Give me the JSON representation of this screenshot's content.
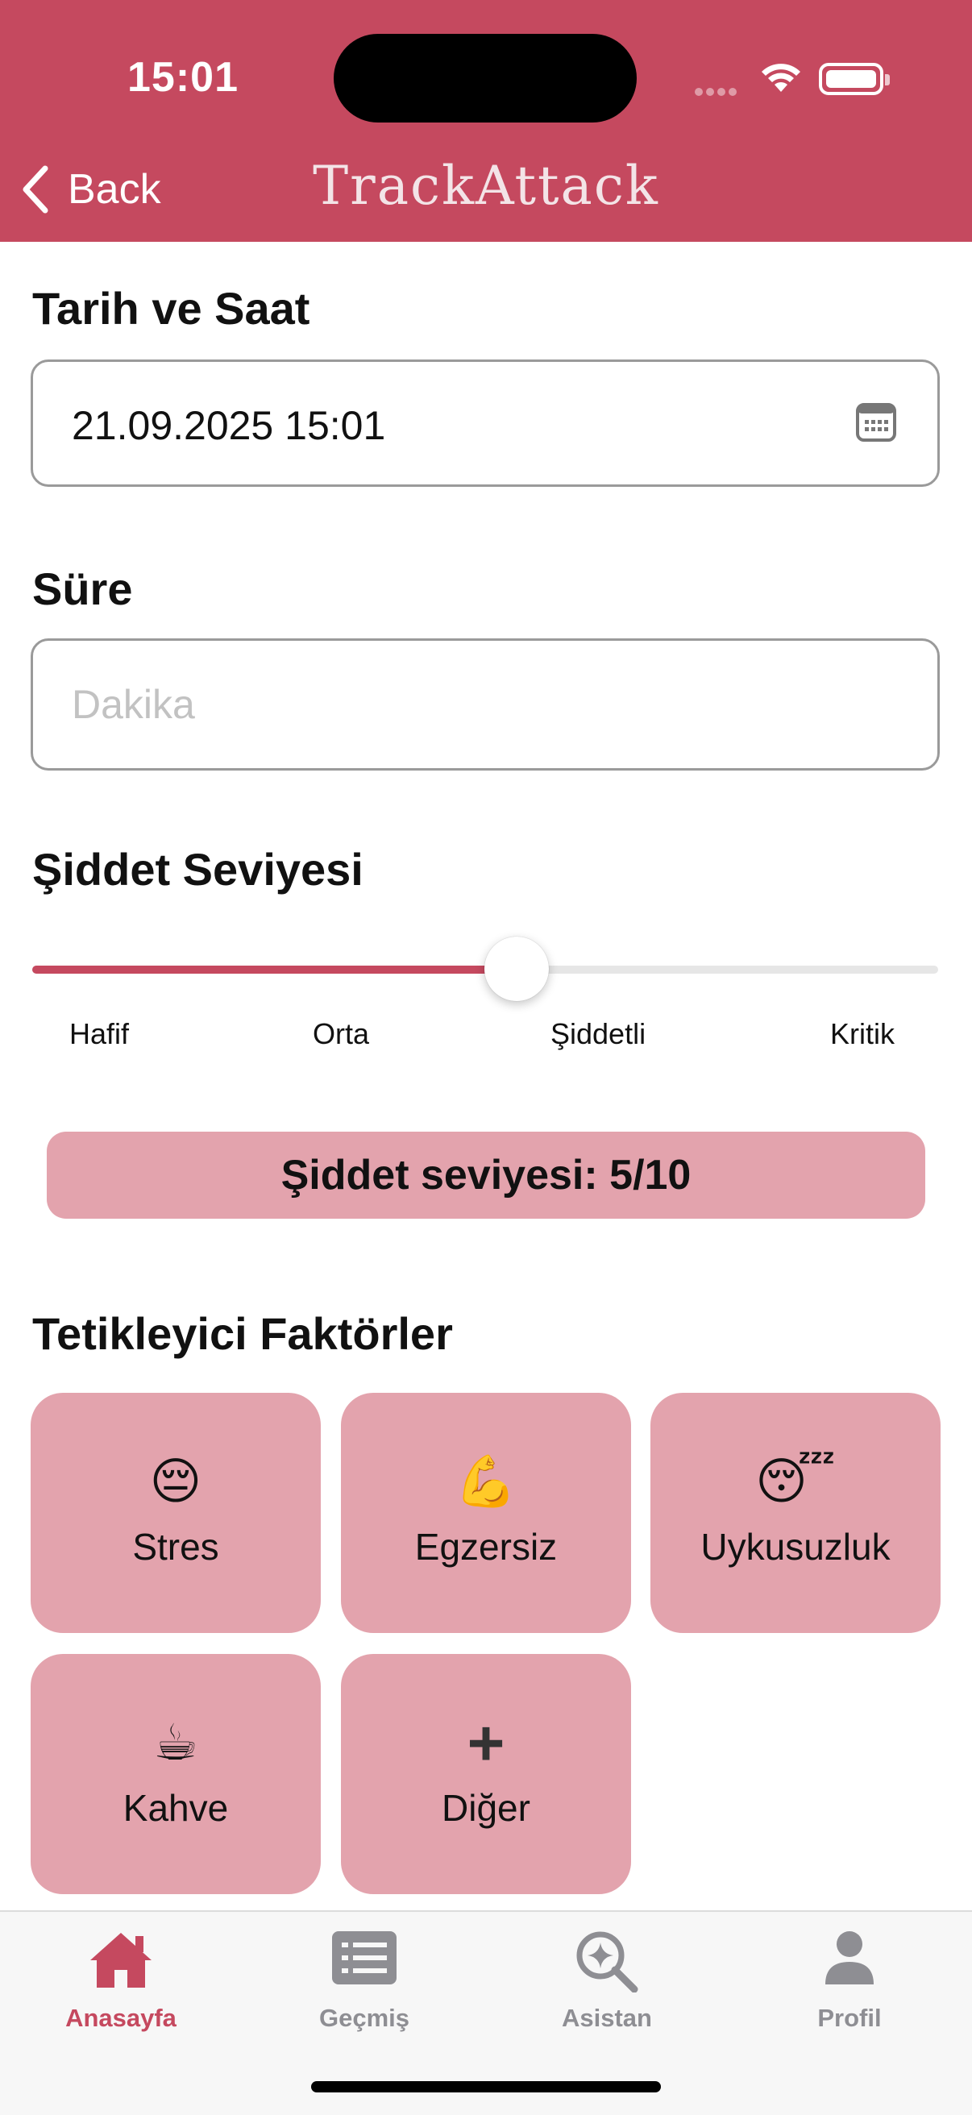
{
  "status_bar": {
    "time": "15:01"
  },
  "nav": {
    "back_label": "Back",
    "title": "TrackAttack"
  },
  "form": {
    "datetime": {
      "label": "Tarih ve Saat",
      "value": "21.09.2025 15:01"
    },
    "duration": {
      "label": "Süre",
      "placeholder": "Dakika",
      "value": ""
    },
    "severity": {
      "label": "Şiddet Seviyesi",
      "value": 5,
      "max": 10,
      "ticks": [
        "Hafif",
        "Orta",
        "Şiddetli",
        "Kritik"
      ],
      "summary": "Şiddet seviyesi: 5/10"
    },
    "triggers": {
      "label": "Tetikleyici Faktörler",
      "items": [
        {
          "emoji": "😔",
          "label": "Stres"
        },
        {
          "emoji": "💪",
          "label": "Egzersiz"
        },
        {
          "emoji": "😴",
          "label": "Uykusuzluk"
        },
        {
          "emoji": "☕",
          "label": "Kahve"
        },
        {
          "emoji": "+",
          "label": "Diğer"
        }
      ]
    }
  },
  "tabbar": {
    "items": [
      {
        "label": "Anasayfa",
        "icon": "house-icon",
        "active": true
      },
      {
        "label": "Geçmiş",
        "icon": "list-icon",
        "active": false
      },
      {
        "label": "Asistan",
        "icon": "sparkle-search-icon",
        "active": false
      },
      {
        "label": "Profil",
        "icon": "person-icon",
        "active": false
      }
    ]
  },
  "colors": {
    "accent": "#c5495f",
    "tile": "#e3a3ad",
    "inactive": "#8e8e93"
  }
}
